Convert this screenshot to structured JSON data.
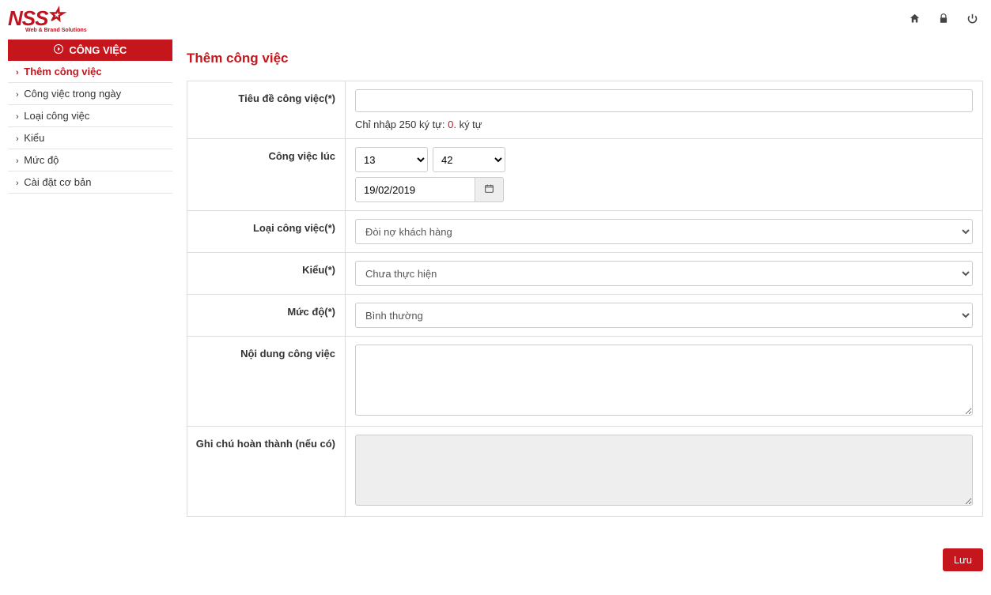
{
  "brand": {
    "name": "NSS",
    "tagline": "Web & Brand Solutions"
  },
  "topbar": {
    "home_icon": "home",
    "lock_icon": "lock",
    "power_icon": "power"
  },
  "sidebar": {
    "header": "CÔNG VIỆC",
    "items": [
      {
        "label": "Thêm công việc",
        "active": true
      },
      {
        "label": "Công việc trong ngày",
        "active": false
      },
      {
        "label": "Loại công việc",
        "active": false
      },
      {
        "label": "Kiểu",
        "active": false
      },
      {
        "label": "Mức độ",
        "active": false
      },
      {
        "label": "Cài đặt cơ bản",
        "active": false
      }
    ]
  },
  "page": {
    "title": "Thêm công việc"
  },
  "form": {
    "title": {
      "label": "Tiêu đề công việc(*)",
      "value": "",
      "hint_prefix": "Chỉ nhập 250 ký tự: ",
      "hint_count": "0.",
      "hint_suffix": " ký tự"
    },
    "schedule": {
      "label": "Công việc lúc",
      "hour": "13",
      "minute": "42",
      "date": "19/02/2019"
    },
    "type": {
      "label": "Loại công việc(*)",
      "value": "Đòi nợ khách hàng"
    },
    "style": {
      "label": "Kiểu(*)",
      "value": "Chưa thực hiện"
    },
    "level": {
      "label": "Mức độ(*)",
      "value": "Bình thường"
    },
    "content": {
      "label": "Nội dung công việc",
      "value": ""
    },
    "note": {
      "label": "Ghi chú hoàn thành (nếu có)",
      "value": ""
    }
  },
  "actions": {
    "save": "Lưu"
  }
}
